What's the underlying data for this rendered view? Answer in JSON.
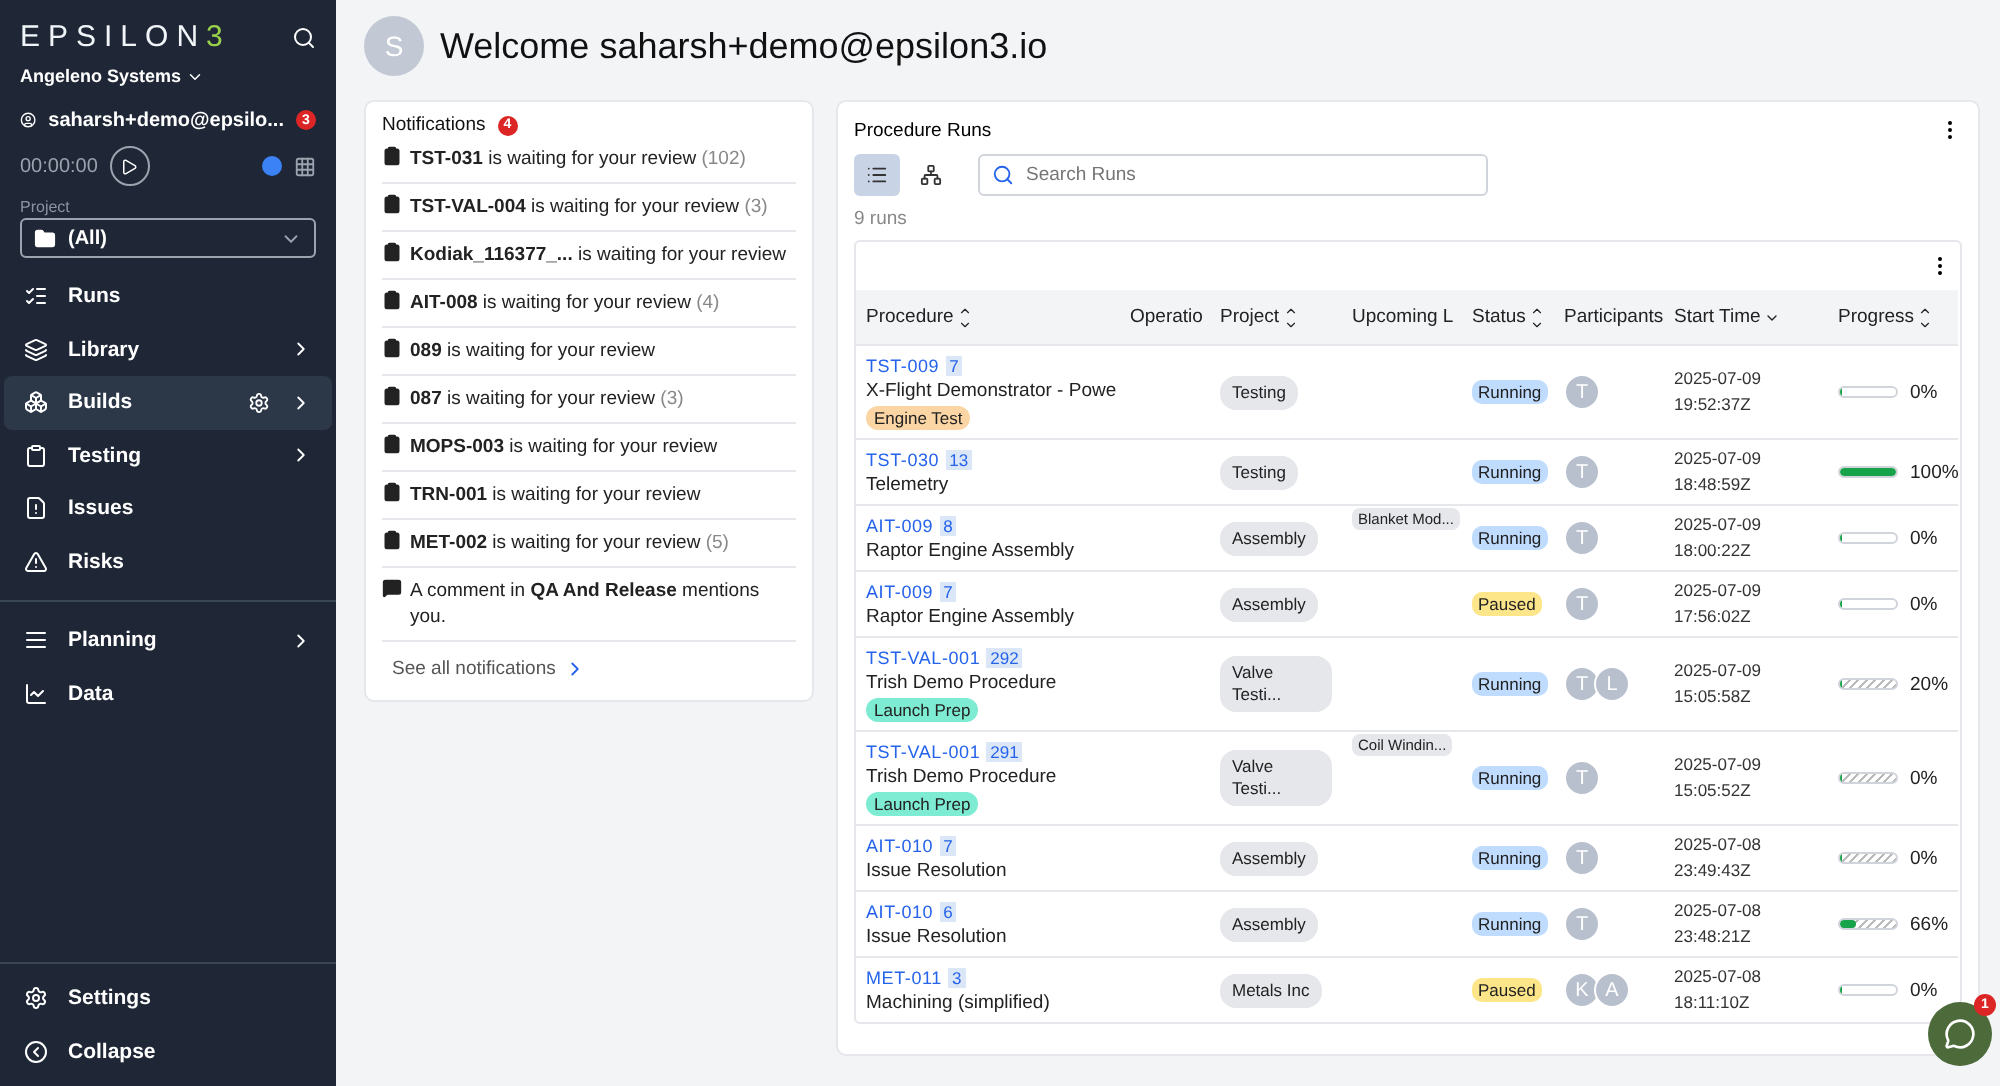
{
  "sidebar": {
    "logo": {
      "text": "EPSILON",
      "accent": "3"
    },
    "org": "Angeleno Systems",
    "user": {
      "name": "saharsh+demo@epsilo...",
      "badge": "3"
    },
    "timer": "00:00:00",
    "project": {
      "label": "Project",
      "value": "(All)"
    },
    "nav": [
      [
        {
          "label": "Runs",
          "submenu": false,
          "highlighted": false
        },
        {
          "label": "Library",
          "submenu": true,
          "highlighted": false
        },
        {
          "label": "Builds",
          "submenu": true,
          "highlighted": true
        },
        {
          "label": "Testing",
          "submenu": true,
          "highlighted": false
        },
        {
          "label": "Issues",
          "submenu": false,
          "highlighted": false
        },
        {
          "label": "Risks",
          "submenu": false,
          "highlighted": false
        }
      ],
      [
        {
          "label": "Planning",
          "submenu": true,
          "highlighted": false
        },
        {
          "label": "Data",
          "submenu": false,
          "highlighted": false
        }
      ]
    ],
    "footer": [
      {
        "label": "Settings"
      },
      {
        "label": "Collapse"
      }
    ]
  },
  "header": {
    "avatar": "S",
    "title": "Welcome saharsh+demo@epsilon3.io"
  },
  "notifications": {
    "title": "Notifications",
    "badge": "4",
    "items": [
      {
        "kind": "review",
        "text": "**TST-031** is waiting for your review",
        "count": "(102)"
      },
      {
        "kind": "review",
        "text": "**TST-VAL-004** is waiting for your review",
        "count": "(3)"
      },
      {
        "kind": "review",
        "text": "**Kodiak_116377_...** is waiting for your review"
      },
      {
        "kind": "review",
        "text": "**AIT-008** is waiting for your review",
        "count": "(4)"
      },
      {
        "kind": "review",
        "text": "**089** is waiting for your review"
      },
      {
        "kind": "review",
        "text": "**087** is waiting for your review",
        "count": "(3)"
      },
      {
        "kind": "review",
        "text": "**MOPS-003** is waiting for your review"
      },
      {
        "kind": "review",
        "text": "**TRN-001** is waiting for your review"
      },
      {
        "kind": "review",
        "text": "**MET-002** is waiting for your review",
        "count": "(5)"
      },
      {
        "kind": "comment",
        "text": "A comment in **QA And Release** mentions you."
      }
    ],
    "footer": "See all notifications"
  },
  "runs": {
    "title": "Procedure Runs",
    "views": [
      {
        "kind": "list",
        "selected": true
      },
      {
        "kind": "tree",
        "selected": false
      }
    ],
    "search": {
      "placeholder": "Search Runs"
    },
    "count": "9 runs",
    "columns": [
      {
        "label": "Procedure",
        "sortable": true,
        "sorted": false
      },
      {
        "label": "Operatio",
        "sortable": false,
        "sorted": false
      },
      {
        "label": "Project",
        "sortable": true,
        "sorted": false
      },
      {
        "label": "Upcoming L",
        "sortable": false,
        "sorted": false
      },
      {
        "label": "Status",
        "sortable": true,
        "sorted": false
      },
      {
        "label": "Participants",
        "sortable": false,
        "sorted": false
      },
      {
        "label": "Start Time",
        "sortable": true,
        "sorted": true
      },
      {
        "label": "Progress",
        "sortable": true,
        "sorted": false
      }
    ],
    "rows": [
      {
        "id": "TST-009",
        "run": "7",
        "name": "X-Flight Demonstrator - Powe",
        "tag": {
          "label": "Engine Test",
          "color": "#fcd5a5"
        },
        "project": "Testing",
        "status": {
          "label": "Running",
          "color": "#bfdbfe"
        },
        "participants": [
          "T"
        ],
        "date": "2025-07-09",
        "time": "19:52:37Z",
        "level": 0,
        "striped": false,
        "progress": "0%"
      },
      {
        "id": "TST-030",
        "run": "13",
        "name": "Telemetry",
        "project": "Testing",
        "status": {
          "label": "Running",
          "color": "#bfdbfe"
        },
        "participants": [
          "T"
        ],
        "date": "2025-07-09",
        "time": "18:48:59Z",
        "level": 1,
        "striped": false,
        "progress": "100%"
      },
      {
        "id": "AIT-009",
        "run": "8",
        "name": "Raptor Engine Assembly",
        "project": "Assembly",
        "upcoming": "Blanket Mod...",
        "status": {
          "label": "Running",
          "color": "#bfdbfe"
        },
        "participants": [
          "T"
        ],
        "date": "2025-07-09",
        "time": "18:00:22Z",
        "level": 0,
        "striped": false,
        "progress": "0%"
      },
      {
        "id": "AIT-009",
        "run": "7",
        "name": "Raptor Engine Assembly",
        "project": "Assembly",
        "status": {
          "label": "Paused",
          "color": "#fde68a"
        },
        "participants": [
          "T"
        ],
        "date": "2025-07-09",
        "time": "17:56:02Z",
        "level": 0,
        "striped": false,
        "progress": "0%"
      },
      {
        "id": "TST-VAL-001",
        "run": "292",
        "name": "Trish Demo Procedure",
        "tag": {
          "label": "Launch Prep",
          "color": "#7eebd3"
        },
        "project": "Valve Testi...",
        "status": {
          "label": "Running",
          "color": "#bfdbfe"
        },
        "participants": [
          "T",
          "L"
        ],
        "date": "2025-07-09",
        "time": "15:05:58Z",
        "level": 0,
        "striped": true,
        "progress": "20%"
      },
      {
        "id": "TST-VAL-001",
        "run": "291",
        "name": "Trish Demo Procedure",
        "tag": {
          "label": "Launch Prep",
          "color": "#7eebd3"
        },
        "project": "Valve Testi...",
        "upcoming": "Coil Windin...",
        "status": {
          "label": "Running",
          "color": "#bfdbfe"
        },
        "participants": [
          "T"
        ],
        "date": "2025-07-09",
        "time": "15:05:52Z",
        "level": 0,
        "striped": true,
        "progress": "0%"
      },
      {
        "id": "AIT-010",
        "run": "7",
        "name": "Issue Resolution",
        "project": "Assembly",
        "status": {
          "label": "Running",
          "color": "#bfdbfe"
        },
        "participants": [
          "T"
        ],
        "date": "2025-07-08",
        "time": "23:49:43Z",
        "level": 0,
        "striped": true,
        "progress": "0%"
      },
      {
        "id": "AIT-010",
        "run": "6",
        "name": "Issue Resolution",
        "project": "Assembly",
        "status": {
          "label": "Running",
          "color": "#bfdbfe"
        },
        "participants": [
          "T"
        ],
        "date": "2025-07-08",
        "time": "23:48:21Z",
        "level": 0.3,
        "striped": true,
        "progress": "66%"
      },
      {
        "id": "MET-011",
        "run": "3",
        "name": "Machining (simplified)",
        "project": "Metals Inc",
        "status": {
          "label": "Paused",
          "color": "#fde68a"
        },
        "participants": [
          "K",
          "A"
        ],
        "date": "2025-07-08",
        "time": "18:11:10Z",
        "level": 0,
        "striped": false,
        "progress": "0%"
      }
    ]
  },
  "chat": {
    "badge": "1"
  }
}
